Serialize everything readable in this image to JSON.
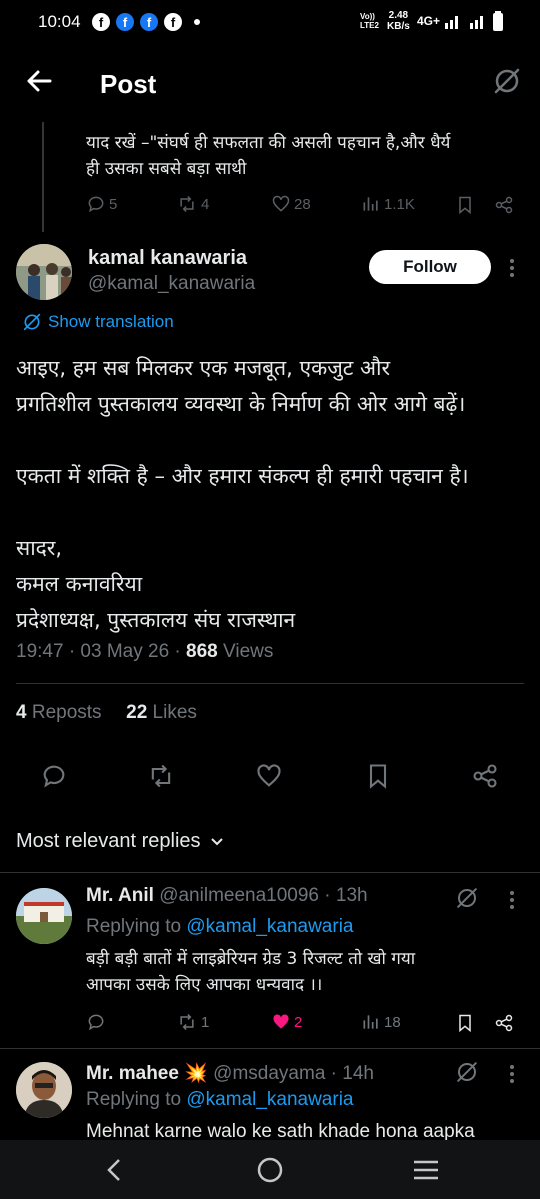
{
  "status_bar": {
    "time": "10:04",
    "net_label": "VoLTE2",
    "speed": "2.48",
    "speed_unit": "KB/s",
    "network": "4G+"
  },
  "header": {
    "title": "Post"
  },
  "prev_post": {
    "text_line1": "याद रखें –\"संघर्ष ही सफलता की असली पहचान है,और धैर्य",
    "text_line2": "ही उसका सबसे बड़ा साथी",
    "replies": "5",
    "reposts": "4",
    "likes": "28",
    "views": "1.1K"
  },
  "main_post": {
    "author_name": "kamal kanawaria",
    "author_handle": "@kamal_kanawaria",
    "follow_label": "Follow",
    "translate_label": "Show translation",
    "para1_line1": "आइए, हम सब मिलकर एक मजबूत, एकजुट और",
    "para1_line2": "प्रगतिशील पुस्तकालय व्यवस्था के निर्माण की ओर आगे बढ़ें।",
    "para2": "एकता में शक्ति है – और हमारा संकल्प ही हमारी पहचान है।",
    "sign1": "सादर,",
    "sign2": "कमल कनावरिया",
    "sign3": "प्रदेशाध्यक्ष, पुस्तकालय संघ राजस्थान",
    "meta_time": "19:47 · 03 May 26 · ",
    "views_count": "868",
    "views_label": " Views",
    "reposts_count": "4",
    "reposts_label": " Reposts",
    "likes_count": "22",
    "likes_label": " Likes"
  },
  "replies_section": {
    "sort_label": "Most relevant replies"
  },
  "replies": [
    {
      "name": "Mr. Anil",
      "meta": "@anilmeena10096 · 13h",
      "replying_prefix": "Replying to ",
      "replying_handle": "@kamal_kanawaria",
      "text_line1": "बड़ी बड़ी बातों में लाइब्रेरियन ग्रेड 3 रिजल्ट तो खो गया",
      "text_line2": "आपका उसके लिए आपका धन्यवाद ।।",
      "replies": "",
      "reposts": "1",
      "likes": "2",
      "views": "18"
    },
    {
      "name": "Mr. mahee",
      "emoji": "💥",
      "meta": "@msdayama · 14h",
      "replying_prefix": "Replying to ",
      "replying_handle": "@kamal_kanawaria",
      "text_line1": "Mehnat karne walo ke sath khade hona aapka"
    }
  ],
  "colors": {
    "accent": "#1d9bf0",
    "like_active": "#f91880",
    "muted": "#71767b",
    "background": "#000000"
  }
}
